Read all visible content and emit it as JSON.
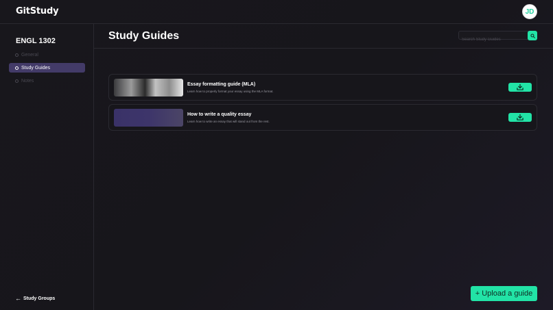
{
  "app": {
    "name": "GitStudy"
  },
  "user": {
    "initials": "JD"
  },
  "sidebar": {
    "course": "ENGL 1302",
    "items": [
      {
        "label": "General",
        "active": false
      },
      {
        "label": "Study Guides",
        "active": true
      },
      {
        "label": "Notes",
        "active": false
      }
    ],
    "back_label": "Study Groups"
  },
  "main": {
    "title": "Study Guides",
    "search": {
      "placeholder": "Search Study Guides",
      "value": ""
    },
    "guides": [
      {
        "title": "Essay formatting guide (MLA)",
        "description": "Learn how to properly format your essay using the MLA format.",
        "thumbnail": "photo"
      },
      {
        "title": "How to write a quality essay",
        "description": "Learn how to write an essay that will stand out from the rest.",
        "thumbnail": "purple-gradient"
      }
    ],
    "upload_label": "+ Upload a guide"
  },
  "colors": {
    "accent": "#22e3a6",
    "active_nav": "#433b68",
    "background": "#17161b"
  },
  "icons": {
    "search": "search-icon",
    "download": "download-icon",
    "back": "arrow-left-icon"
  }
}
